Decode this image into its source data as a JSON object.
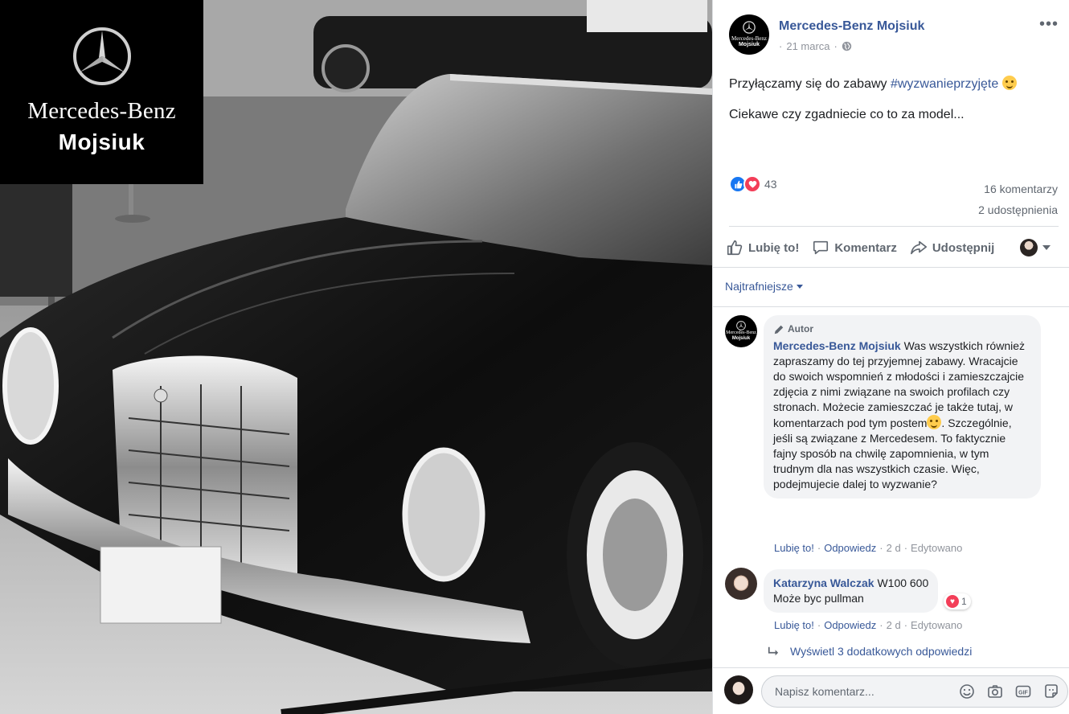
{
  "logo": {
    "brand": "Mercedes-Benz",
    "dealer": "Mojsiuk"
  },
  "post": {
    "page_name": "Mercedes-Benz Mojsiuk",
    "date": "21 marca",
    "privacy_icon": "globe-icon",
    "text_line1_prefix": "Przyłączamy się do zabawy ",
    "hashtag": "#wyzwanieprzyjęte",
    "text_line2": "Ciekawe czy zgadniecie co to za model...",
    "reactions_count": "43",
    "comments_count": "16 komentarzy",
    "shares_count": "2 udostępnienia"
  },
  "actions": {
    "like": "Lubię to!",
    "comment": "Komentarz",
    "share": "Udostępnij"
  },
  "sort": {
    "label": "Najtrafniejsze"
  },
  "comments": [
    {
      "badge": "Autor",
      "author": "Mercedes-Benz Mojsiuk",
      "text_part1": "Was wszystkich również zapraszamy do tej przyjemnej zabawy. Wracajcie do swoich wspomnień z młodości i zamieszczajcie zdjęcia z nimi związane na swoich profilach czy stronach. Możecie zamieszczać je także tutaj, w komentarzach pod tym postem",
      "text_part2": ". Szczególnie, jeśli są związane z Mercedesem. To faktycznie fajny sposób na chwilę zapomnienia, w tym trudnym dla nas wszystkich czasie. Więc, podejmujecie dalej to wyzwanie?",
      "like": "Lubię to!",
      "reply": "Odpowiedz",
      "time": "2 d",
      "edited": "Edytowano"
    },
    {
      "author": "Katarzyna Walczak",
      "text_line1": "W100 600",
      "text_line2": "Może byc pullman",
      "heart_count": "1",
      "like": "Lubię to!",
      "reply": "Odpowiedz",
      "time": "2 d",
      "edited": "Edytowano"
    }
  ],
  "more_replies": "Wyświetl 3 dodatkowych odpowiedzi",
  "composer": {
    "placeholder": "Napisz komentarz..."
  },
  "colors": {
    "link": "#385898",
    "like_blue": "#1877f2",
    "love_red": "#f33e58",
    "muted": "#606770"
  }
}
